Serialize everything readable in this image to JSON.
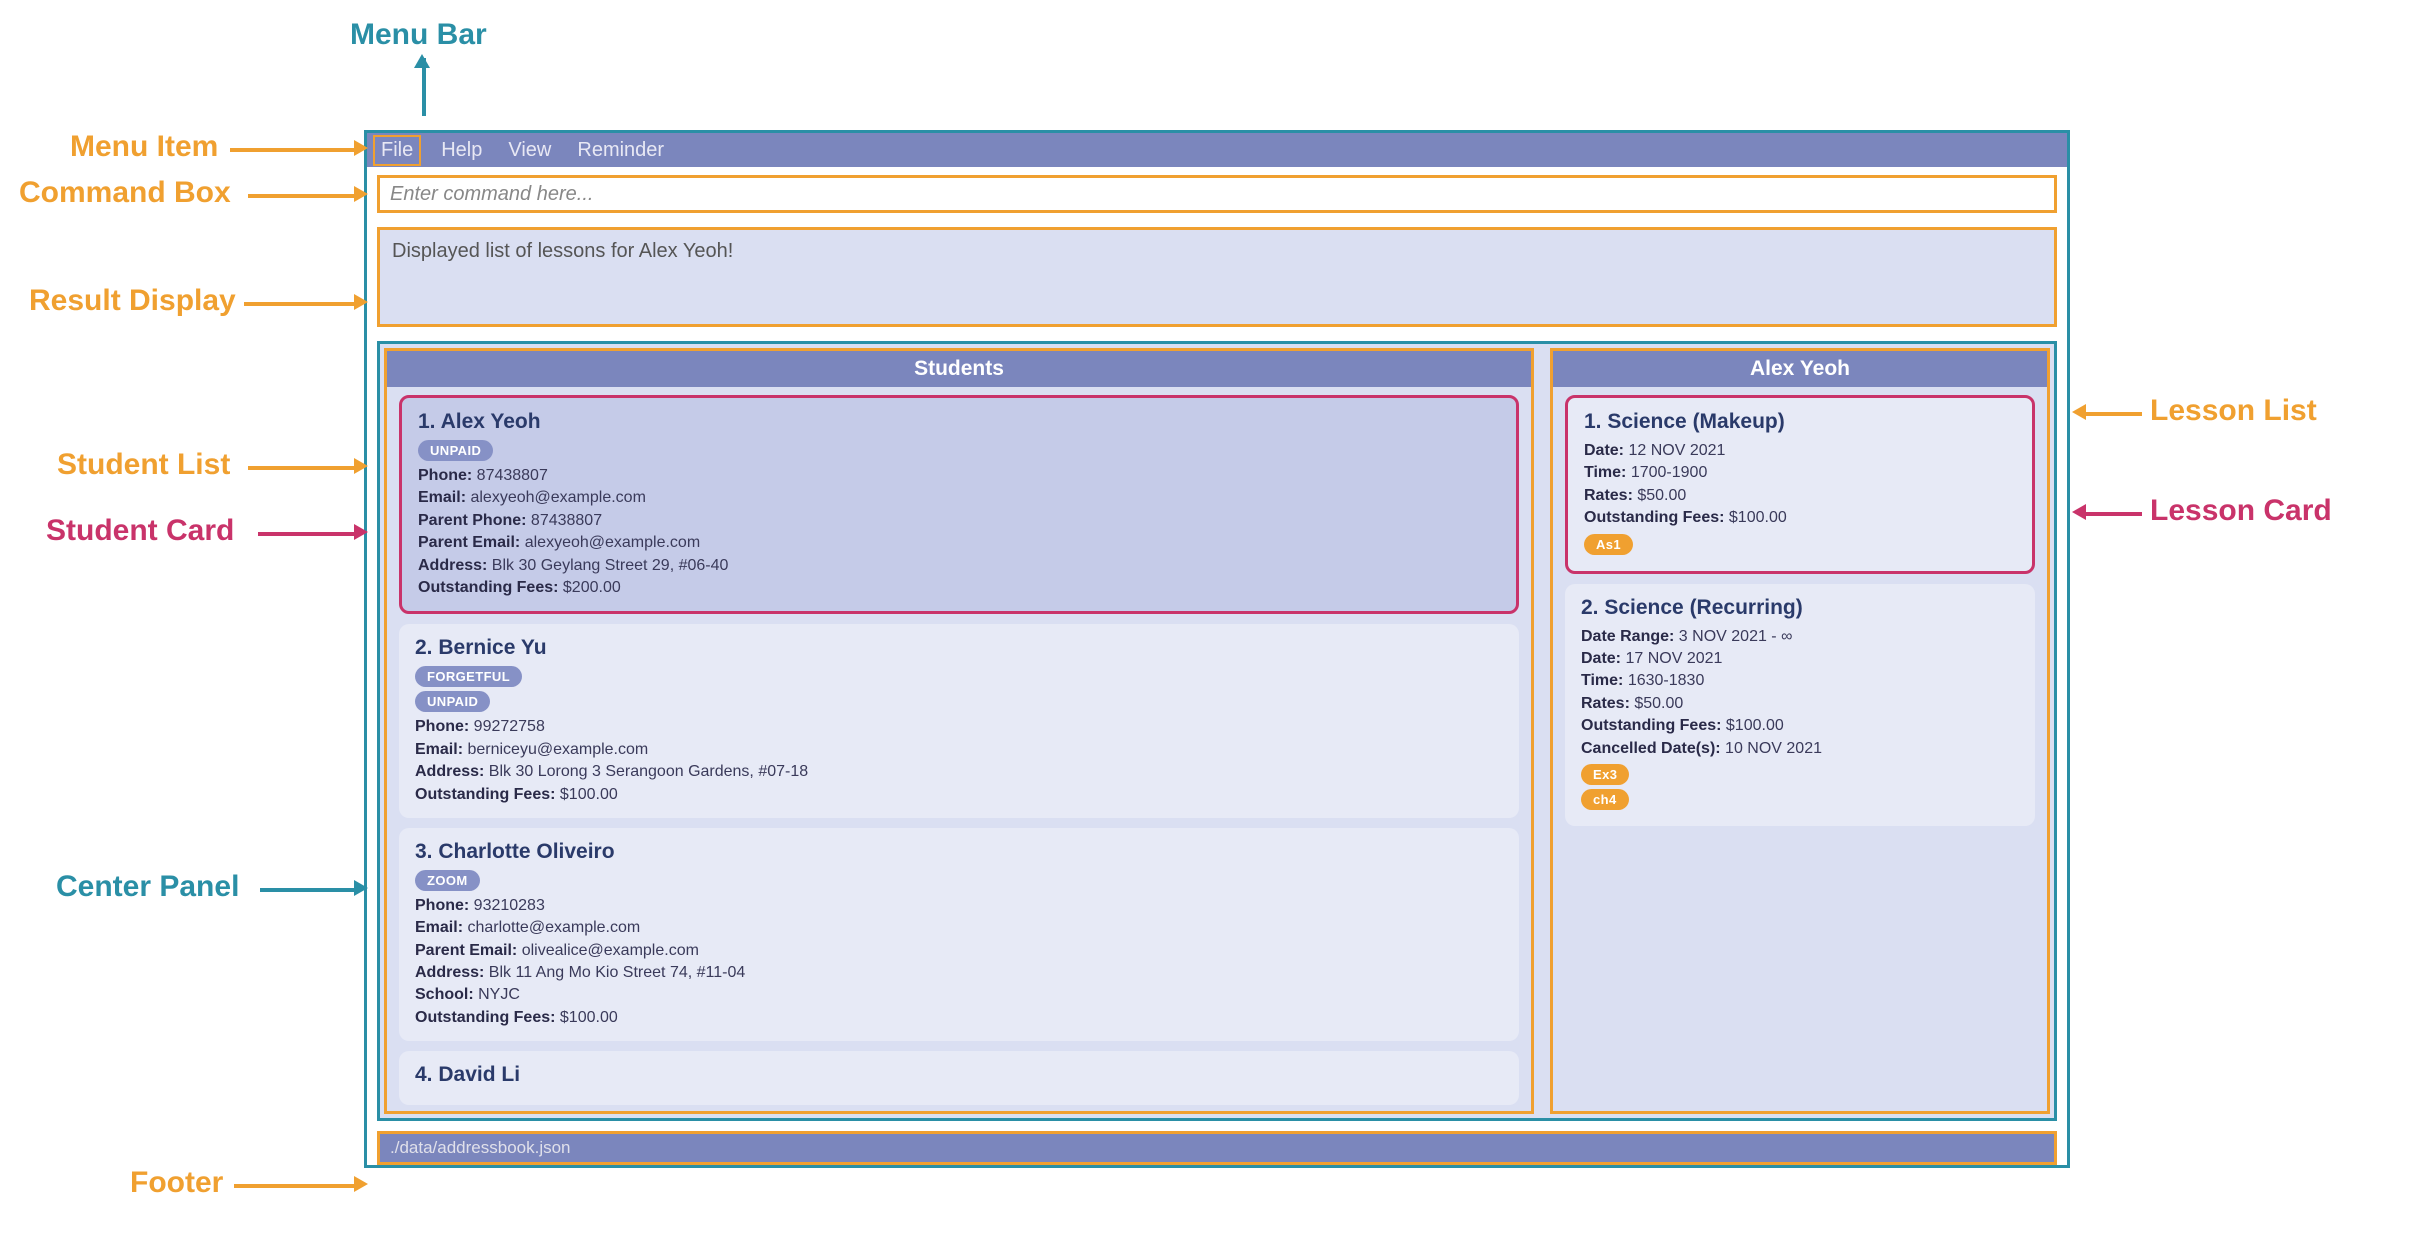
{
  "annotations": {
    "menu_bar": "Menu Bar",
    "menu_item": "Menu Item",
    "command_box": "Command Box",
    "result_display": "Result Display",
    "student_list": "Student List",
    "student_card": "Student Card",
    "center_panel": "Center Panel",
    "footer": "Footer",
    "lesson_list": "Lesson List",
    "lesson_card": "Lesson Card"
  },
  "menu": {
    "items": [
      "File",
      "Help",
      "View",
      "Reminder"
    ]
  },
  "command_box": {
    "placeholder": "Enter command here..."
  },
  "result_display": {
    "text": "Displayed list of lessons for Alex Yeoh!"
  },
  "student_list": {
    "header": "Students",
    "cards": [
      {
        "index": "1.",
        "name": "Alex Yeoh",
        "tags": [
          "UNPAID"
        ],
        "fields": [
          {
            "label": "Phone:",
            "value": "87438807"
          },
          {
            "label": "Email:",
            "value": "alexyeoh@example.com"
          },
          {
            "label": "Parent Phone:",
            "value": "87438807"
          },
          {
            "label": "Parent Email:",
            "value": "alexyeoh@example.com"
          },
          {
            "label": "Address:",
            "value": "Blk 30 Geylang Street 29, #06-40"
          },
          {
            "label": "Outstanding Fees:",
            "value": "$200.00"
          }
        ],
        "selected": true,
        "highlighted": true
      },
      {
        "index": "2.",
        "name": "Bernice Yu",
        "tags": [
          "FORGETFUL",
          "UNPAID"
        ],
        "fields": [
          {
            "label": "Phone:",
            "value": "99272758"
          },
          {
            "label": "Email:",
            "value": "berniceyu@example.com"
          },
          {
            "label": "Address:",
            "value": "Blk 30 Lorong 3 Serangoon Gardens, #07-18"
          },
          {
            "label": "Outstanding Fees:",
            "value": "$100.00"
          }
        ]
      },
      {
        "index": "3.",
        "name": "Charlotte Oliveiro",
        "tags": [
          "ZOOM"
        ],
        "fields": [
          {
            "label": "Phone:",
            "value": "93210283"
          },
          {
            "label": "Email:",
            "value": "charlotte@example.com"
          },
          {
            "label": "Parent Email:",
            "value": "olivealice@example.com"
          },
          {
            "label": "Address:",
            "value": "Blk 11 Ang Mo Kio Street 74, #11-04"
          },
          {
            "label": "School:",
            "value": "NYJC"
          },
          {
            "label": "Outstanding Fees:",
            "value": "$100.00"
          }
        ]
      },
      {
        "index": "4.",
        "name": "David Li",
        "tags": [],
        "fields": []
      }
    ]
  },
  "lesson_list": {
    "header": "Alex Yeoh",
    "cards": [
      {
        "index": "1.",
        "name": "Science (Makeup)",
        "fields": [
          {
            "label": "Date:",
            "value": "12 NOV 2021"
          },
          {
            "label": "Time:",
            "value": "1700-1900"
          },
          {
            "label": "Rates:",
            "value": "$50.00"
          },
          {
            "label": "Outstanding Fees:",
            "value": "$100.00"
          }
        ],
        "badges": [
          "As1"
        ],
        "highlighted": true
      },
      {
        "index": "2.",
        "name": "Science (Recurring)",
        "fields": [
          {
            "label": "Date Range:",
            "value": "3 NOV 2021 - ∞"
          },
          {
            "label": "Date:",
            "value": "17 NOV 2021"
          },
          {
            "label": "Time:",
            "value": "1630-1830"
          },
          {
            "label": "Rates:",
            "value": "$50.00"
          },
          {
            "label": "Outstanding Fees:",
            "value": "$100.00"
          },
          {
            "label": "Cancelled Date(s):",
            "value": "10 NOV 2021"
          }
        ],
        "badges": [
          "Ex3",
          "ch4"
        ]
      }
    ]
  },
  "footer": {
    "path": "./data/addressbook.json"
  },
  "colors": {
    "teal": "#2a8fa6",
    "orange": "#f0a030",
    "pink": "#c9336a",
    "lavender": "#7b86bd",
    "panel_bg": "#dadff2",
    "card_bg": "#e7eaf6"
  }
}
